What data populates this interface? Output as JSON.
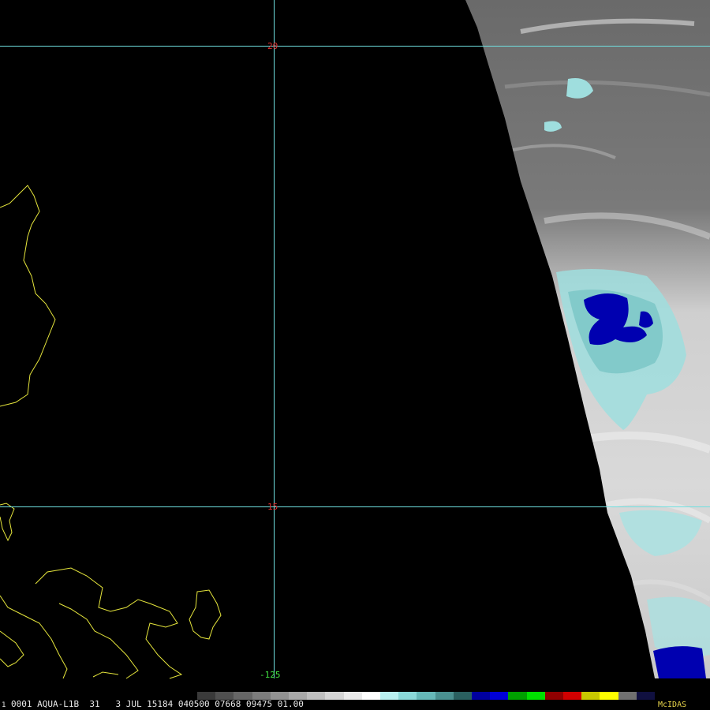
{
  "grid": {
    "lat_labels": [
      "20",
      "15"
    ],
    "lon_labels": [
      "-125"
    ],
    "line_color": "#6fe0e0",
    "lat_label_color": "#e03030",
    "lon_label_color": "#40e040"
  },
  "coast_color": "#e6e63c",
  "status": {
    "frame": "1",
    "text": "0001 AQUA-L1B  31   3 JUL 15184 040500 07668 09475 01.00"
  },
  "colorbar": [
    "#3a3a3a",
    "#505050",
    "#666666",
    "#7c7c7c",
    "#929292",
    "#a8a8a8",
    "#bebebe",
    "#d4d4d4",
    "#eaeaea",
    "#ffffff",
    "#b8f0f0",
    "#8ad8d8",
    "#66b8b8",
    "#4a9090",
    "#2a6060",
    "#0000a0",
    "#0000d8",
    "#00a000",
    "#00e000",
    "#900000",
    "#d00000",
    "#c8c800",
    "#ffff00",
    "#707070",
    "#101040"
  ],
  "brand": "McIDAS",
  "brand_color": "#e6d34a"
}
